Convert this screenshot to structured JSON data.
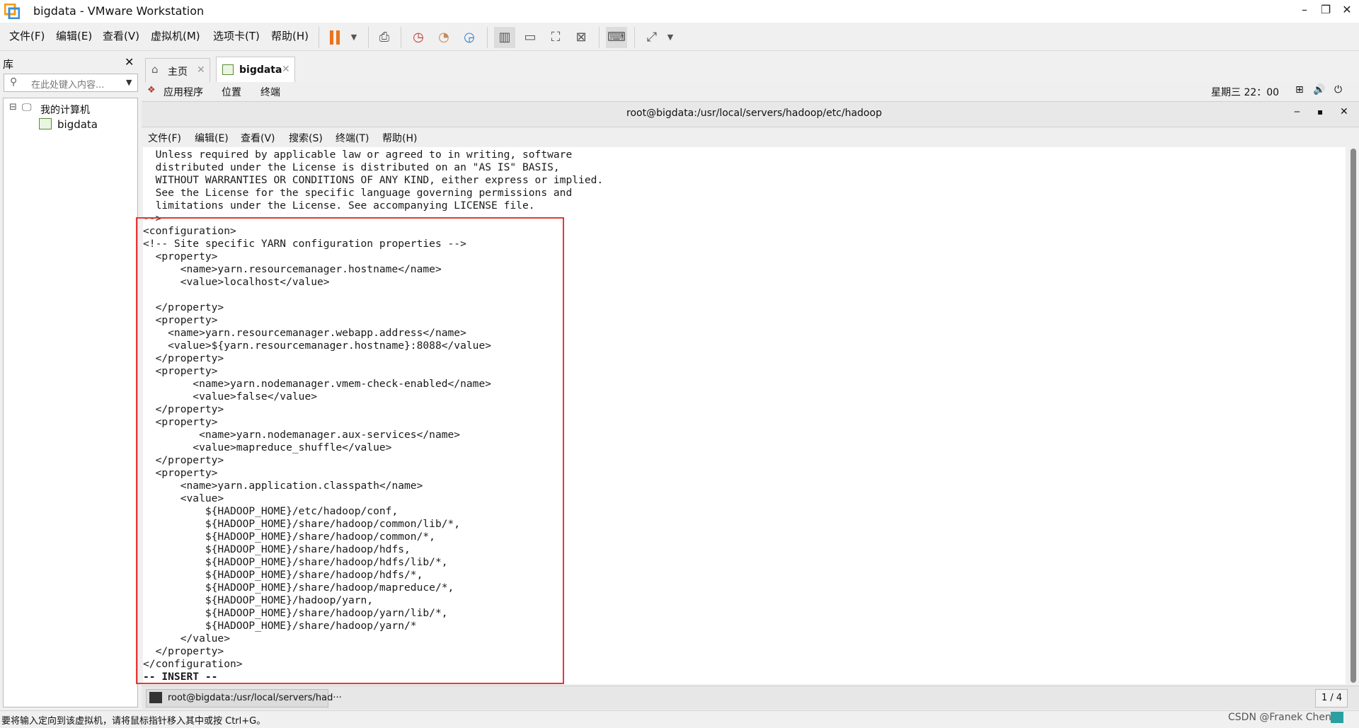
{
  "window": {
    "title": "bigdata - VMware Workstation",
    "minimize": "–",
    "restore": "❐",
    "close": "✕"
  },
  "menubar": {
    "items": [
      "文件(F)",
      "编辑(E)",
      "查看(V)",
      "虚拟机(M)",
      "选项卡(T)",
      "帮助(H)"
    ]
  },
  "library": {
    "title": "库",
    "close": "✕",
    "search_placeholder": "在此处键入内容...",
    "tree": {
      "root": "我的计算机",
      "child": "bigdata",
      "expander": "⊟"
    }
  },
  "tabs": [
    {
      "label": "主页",
      "close": "✕"
    },
    {
      "label": "bigdata",
      "close": "✕"
    }
  ],
  "gnome_panel": {
    "apps": "应用程序",
    "places": "位置",
    "terminal": "终端",
    "clock": "星期三 22：00"
  },
  "terminal": {
    "title": "root@bigdata:/usr/local/servers/hadoop/etc/hadoop",
    "menu": [
      "文件(F)",
      "编辑(E)",
      "查看(V)",
      "搜索(S)",
      "终端(T)",
      "帮助(H)"
    ],
    "lines": [
      "  Unless required by applicable law or agreed to in writing, software",
      "  distributed under the License is distributed on an \"AS IS\" BASIS,",
      "  WITHOUT WARRANTIES OR CONDITIONS OF ANY KIND, either express or implied.",
      "  See the License for the specific language governing permissions and",
      "  limitations under the License. See accompanying LICENSE file.",
      "-->",
      "<configuration>",
      "<!-- Site specific YARN configuration properties -->",
      "  <property>",
      "      <name>yarn.resourcemanager.hostname</name>",
      "      <value>localhost</value>",
      "",
      "  </property>",
      "  <property>",
      "    <name>yarn.resourcemanager.webapp.address</name>",
      "    <value>${yarn.resourcemanager.hostname}:8088</value>",
      "  </property>",
      "  <property>",
      "        <name>yarn.nodemanager.vmem-check-enabled</name>",
      "        <value>false</value>",
      "  </property>",
      "  <property>",
      "         <name>yarn.nodemanager.aux-services</name>",
      "        <value>mapreduce_shuffle</value>",
      "  </property>",
      "  <property>",
      "      <name>yarn.application.classpath</name>",
      "      <value>",
      "          ${HADOOP_HOME}/etc/hadoop/conf,",
      "          ${HADOOP_HOME}/share/hadoop/common/lib/*,",
      "          ${HADOOP_HOME}/share/hadoop/common/*,",
      "          ${HADOOP_HOME}/share/hadoop/hdfs,",
      "          ${HADOOP_HOME}/share/hadoop/hdfs/lib/*,",
      "          ${HADOOP_HOME}/share/hadoop/hdfs/*,",
      "          ${HADOOP_HOME}/share/hadoop/mapreduce/*,",
      "          ${HADOOP_HOME}/hadoop/yarn,",
      "          ${HADOOP_HOME}/share/hadoop/yarn/lib/*,",
      "          ${HADOOP_HOME}/share/hadoop/yarn/*",
      "      </value>",
      "  </property>",
      "</configuration>",
      "-- INSERT --"
    ]
  },
  "guest_taskbar": {
    "task": "root@bigdata:/usr/local/servers/had···",
    "pager": "1 / 4"
  },
  "statusbar": {
    "message": "要将输入定向到该虚拟机，请将鼠标指针移入其中或按 Ctrl+G。",
    "watermark": "CSDN @Franek Chen"
  }
}
